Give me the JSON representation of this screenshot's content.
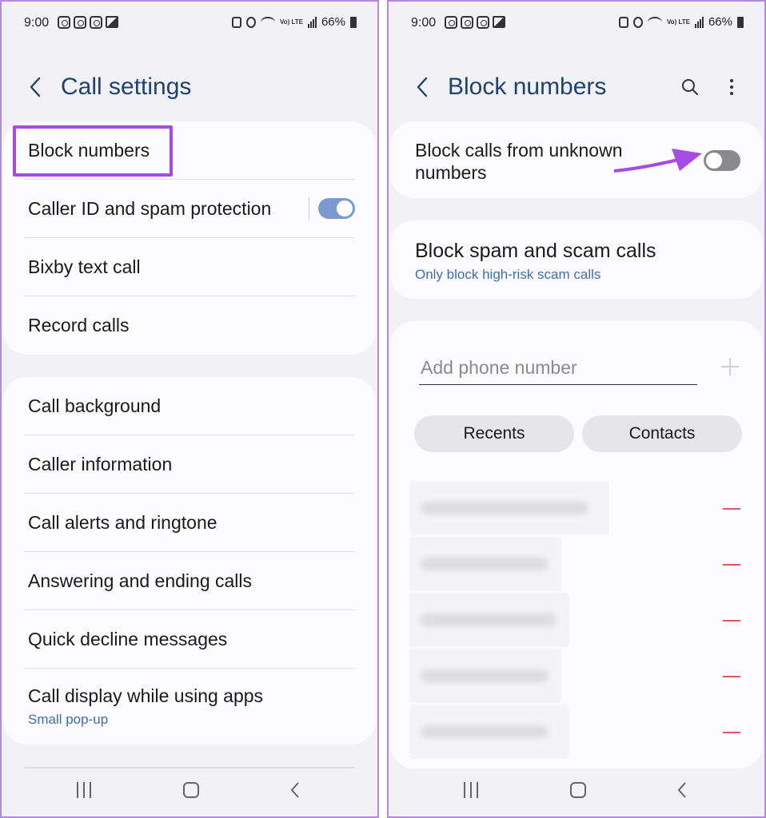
{
  "status_bar": {
    "time": "9:00",
    "battery": "66%",
    "network": "Vo) LTE"
  },
  "left_screen": {
    "header": {
      "title": "Call settings"
    },
    "group1": [
      {
        "label": "Block numbers"
      },
      {
        "label": "Caller ID and spam protection",
        "toggle": "on"
      },
      {
        "label": "Bixby text call"
      },
      {
        "label": "Record calls"
      }
    ],
    "group2": [
      {
        "label": "Call background"
      },
      {
        "label": "Caller information"
      },
      {
        "label": "Call alerts and ringtone"
      },
      {
        "label": "Answering and ending calls"
      },
      {
        "label": "Quick decline messages"
      },
      {
        "label": "Call display while using apps",
        "sub": "Small pop-up"
      }
    ]
  },
  "right_screen": {
    "header": {
      "title": "Block numbers",
      "icons": [
        "search-icon",
        "more-options-icon"
      ]
    },
    "block_unknown": {
      "label": "Block calls from unknown numbers",
      "toggle": "off"
    },
    "block_spam": {
      "label": "Block spam and scam calls",
      "sub": "Only block high-risk scam calls"
    },
    "add_number": {
      "placeholder": "Add phone number",
      "recents_label": "Recents",
      "contacts_label": "Contacts"
    },
    "blocked_count": 5
  },
  "colors": {
    "accent": "#21426f",
    "link": "#3f6bb4",
    "highlight": "#a74be6",
    "remove": "#e0565b",
    "background": "#f2f2f6"
  }
}
